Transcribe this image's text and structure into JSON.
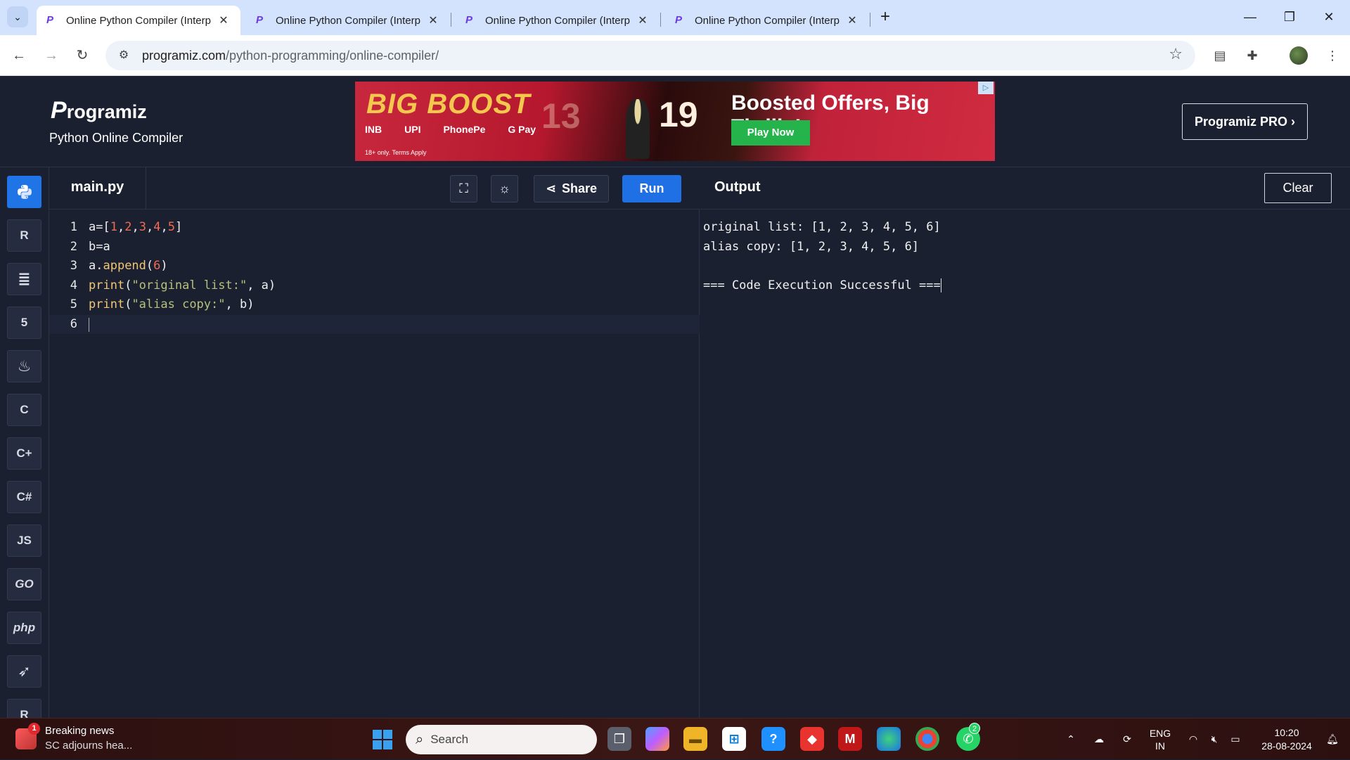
{
  "browser": {
    "tabs": [
      {
        "title": "Online Python Compiler (Interp",
        "active": true
      },
      {
        "title": "Online Python Compiler (Interp",
        "active": false
      },
      {
        "title": "Online Python Compiler (Interp",
        "active": false
      },
      {
        "title": "Online Python Compiler (Interp",
        "active": false
      }
    ],
    "url_host": "programiz.com",
    "url_path": "/python-programming/online-compiler/"
  },
  "header": {
    "logo": "rogramiz",
    "logo_p": "P",
    "subtitle": "Python Online Compiler",
    "pro_button": "Programiz PRO ›"
  },
  "ad": {
    "brand": "BIG BOOST",
    "payments": [
      "INB",
      "UPI",
      "PhonePe",
      "G Pay"
    ],
    "terms": "18+ only. Terms Apply",
    "num1": "13",
    "num2": "19",
    "headline": "Boosted Offers, Big Thrills!",
    "cta": "Play Now"
  },
  "sidebar": {
    "languages": [
      {
        "name": "python",
        "label": "",
        "active": true
      },
      {
        "name": "r",
        "label": "R"
      },
      {
        "name": "sql",
        "label": "≣"
      },
      {
        "name": "html",
        "label": "5"
      },
      {
        "name": "java",
        "label": "♨"
      },
      {
        "name": "c",
        "label": "C"
      },
      {
        "name": "cpp",
        "label": "C+"
      },
      {
        "name": "csharp",
        "label": "C#"
      },
      {
        "name": "javascript",
        "label": "JS"
      },
      {
        "name": "go",
        "label": "GO"
      },
      {
        "name": "php",
        "label": "php"
      },
      {
        "name": "swift",
        "label": "➶"
      },
      {
        "name": "rust",
        "label": "R"
      }
    ]
  },
  "editor": {
    "file_name": "main.py",
    "share_label": "Share",
    "run_label": "Run",
    "lines": [
      {
        "n": "1",
        "code": "a=[1,2,3,4,5]"
      },
      {
        "n": "2",
        "code": "b=a"
      },
      {
        "n": "3",
        "code": "a.append(6)"
      },
      {
        "n": "4",
        "code": "print(\"original list:\", a)"
      },
      {
        "n": "5",
        "code": "print(\"alias copy:\", b)"
      },
      {
        "n": "6",
        "code": ""
      }
    ]
  },
  "output": {
    "title": "Output",
    "clear_label": "Clear",
    "lines": [
      "original list: [1, 2, 3, 4, 5, 6]",
      "alias copy: [1, 2, 3, 4, 5, 6]",
      "",
      "=== Code Execution Successful ==="
    ]
  },
  "taskbar": {
    "news_title": "Breaking news",
    "news_sub": "SC adjourns hea...",
    "news_badge": "1",
    "search_label": "Search",
    "whatsapp_badge": "2",
    "lang_line1": "ENG",
    "lang_line2": "IN",
    "time": "10:20",
    "date": "28-08-2024"
  }
}
